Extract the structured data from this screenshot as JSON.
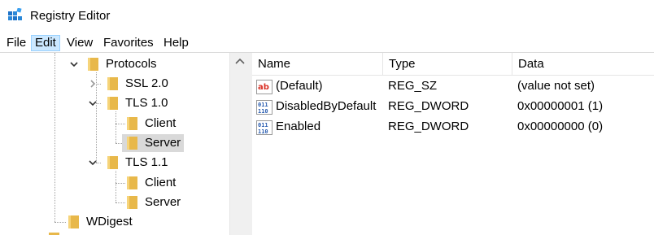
{
  "window": {
    "title": "Registry Editor"
  },
  "menu": [
    "File",
    "Edit",
    "View",
    "Favorites",
    "Help"
  ],
  "menu_active_index": 1,
  "tree": {
    "protocols": "Protocols",
    "ssl20": "SSL 2.0",
    "tls10": "TLS 1.0",
    "tls10_client": "Client",
    "tls10_server": "Server",
    "tls11": "TLS 1.1",
    "tls11_client": "Client",
    "tls11_server": "Server",
    "wdigest": "WDigest"
  },
  "list": {
    "columns": [
      "Name",
      "Type",
      "Data"
    ],
    "rows": [
      {
        "name": "(Default)",
        "type": "REG_SZ",
        "data": "(value not set)",
        "icon": "string-value-icon"
      },
      {
        "name": "DisabledByDefault",
        "type": "REG_DWORD",
        "data": "0x00000001 (1)",
        "icon": "dword-value-icon"
      },
      {
        "name": "Enabled",
        "type": "REG_DWORD",
        "data": "0x00000000 (0)",
        "icon": "dword-value-icon"
      }
    ]
  },
  "colors": {
    "selection": "#d9d9d9",
    "menu_highlight": "#cce8ff",
    "folder": "#e8b84a",
    "string_icon": "#d93025",
    "binary_icon": "#2a5db0"
  }
}
